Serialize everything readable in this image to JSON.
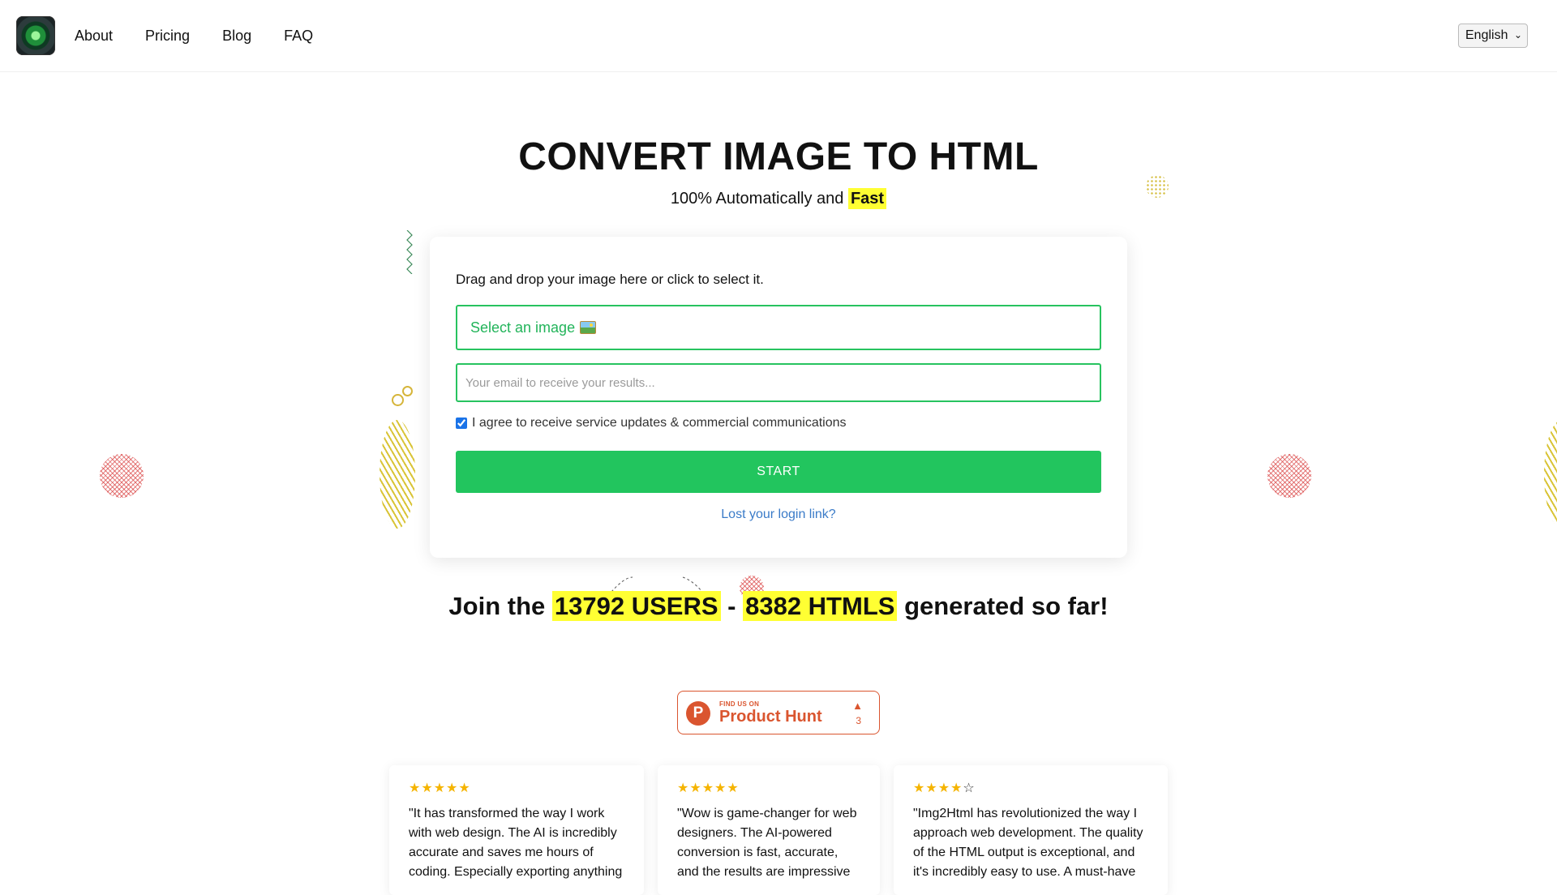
{
  "header": {
    "nav": [
      "About",
      "Pricing",
      "Blog",
      "FAQ"
    ],
    "language": "English"
  },
  "hero": {
    "title": "CONVERT IMAGE TO HTML",
    "subtitle_prefix": "100% Automatically and",
    "subtitle_highlight": "Fast"
  },
  "form": {
    "drop_text": "Drag and drop your image here or click to select it.",
    "select_label": "Select an image",
    "select_icon": "picture-icon",
    "email_value": "",
    "email_placeholder": "Your email to receive your results...",
    "consent_label": "I agree to receive service updates & commercial communications",
    "consent_checked": true,
    "start_label": "START",
    "lost_link": "Lost your login link?"
  },
  "stats": {
    "prefix": "Join the",
    "users": "13792 USERS",
    "separator": "-",
    "htmls": "8382 HTMLS",
    "suffix": "generated so far!"
  },
  "product_hunt": {
    "small_text": "FIND US ON",
    "big_text": "Product Hunt",
    "upvotes": "3"
  },
  "reviews": [
    {
      "rating": 5,
      "text": "\"It has transformed the way I work with web design. The AI is incredibly accurate and saves me hours of coding. Especially exporting anything"
    },
    {
      "rating": 5,
      "text": "\"Wow is game-changer for web designers. The AI-powered conversion is fast, accurate, and the results are impressive"
    },
    {
      "rating": 4,
      "text": "\"Img2Html has revolutionized the way I approach web development. The quality of the HTML output is exceptional, and it's incredibly easy to use. A must-have"
    }
  ],
  "colors": {
    "accent_green": "#22c55e",
    "highlight_yellow": "#ffff33",
    "link_blue": "#3a7bc8",
    "product_hunt": "#da552f"
  }
}
